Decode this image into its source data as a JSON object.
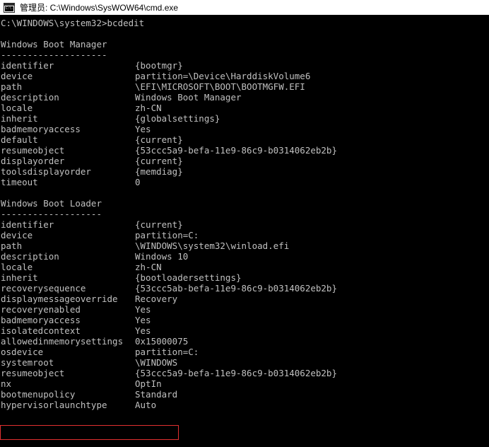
{
  "window": {
    "title": "管理员: C:\\Windows\\SysWOW64\\cmd.exe",
    "icon": "console-window-icon",
    "icon_glyph": "C:\\.",
    "titlebar_bg": "#ffffff",
    "titlebar_fg": "#000000",
    "console_bg": "#000000",
    "console_fg": "#c0c0c0"
  },
  "annotation": {
    "color": "#e03030",
    "target_line": "hypervisorlaunchtype"
  },
  "console": {
    "prompt_line": "C:\\WINDOWS\\system32>bcdedit",
    "sections": [
      {
        "heading": "Windows Boot Manager",
        "rule": "--------------------",
        "entries": [
          {
            "key": "identifier",
            "value": "{bootmgr}"
          },
          {
            "key": "device",
            "value": "partition=\\Device\\HarddiskVolume6"
          },
          {
            "key": "path",
            "value": "\\EFI\\MICROSOFT\\BOOT\\BOOTMGFW.EFI"
          },
          {
            "key": "description",
            "value": "Windows Boot Manager"
          },
          {
            "key": "locale",
            "value": "zh-CN"
          },
          {
            "key": "inherit",
            "value": "{globalsettings}"
          },
          {
            "key": "badmemoryaccess",
            "value": "Yes"
          },
          {
            "key": "default",
            "value": "{current}"
          },
          {
            "key": "resumeobject",
            "value": "{53ccc5a9-befa-11e9-86c9-b0314062eb2b}"
          },
          {
            "key": "displayorder",
            "value": "{current}"
          },
          {
            "key": "toolsdisplayorder",
            "value": "{memdiag}"
          },
          {
            "key": "timeout",
            "value": "0"
          }
        ]
      },
      {
        "heading": "Windows Boot Loader",
        "rule": "-------------------",
        "entries": [
          {
            "key": "identifier",
            "value": "{current}"
          },
          {
            "key": "device",
            "value": "partition=C:"
          },
          {
            "key": "path",
            "value": "\\WINDOWS\\system32\\winload.efi"
          },
          {
            "key": "description",
            "value": "Windows 10"
          },
          {
            "key": "locale",
            "value": "zh-CN"
          },
          {
            "key": "inherit",
            "value": "{bootloadersettings}"
          },
          {
            "key": "recoverysequence",
            "value": "{53ccc5ab-befa-11e9-86c9-b0314062eb2b}"
          },
          {
            "key": "displaymessageoverride",
            "value": "Recovery"
          },
          {
            "key": "recoveryenabled",
            "value": "Yes"
          },
          {
            "key": "badmemoryaccess",
            "value": "Yes"
          },
          {
            "key": "isolatedcontext",
            "value": "Yes"
          },
          {
            "key": "allowedinmemorysettings",
            "value": "0x15000075"
          },
          {
            "key": "osdevice",
            "value": "partition=C:"
          },
          {
            "key": "systemroot",
            "value": "\\WINDOWS"
          },
          {
            "key": "resumeobject",
            "value": "{53ccc5a9-befa-11e9-86c9-b0314062eb2b}"
          },
          {
            "key": "nx",
            "value": "OptIn"
          },
          {
            "key": "bootmenupolicy",
            "value": "Standard"
          },
          {
            "key": "hypervisorlaunchtype",
            "value": "Auto"
          }
        ]
      }
    ]
  }
}
